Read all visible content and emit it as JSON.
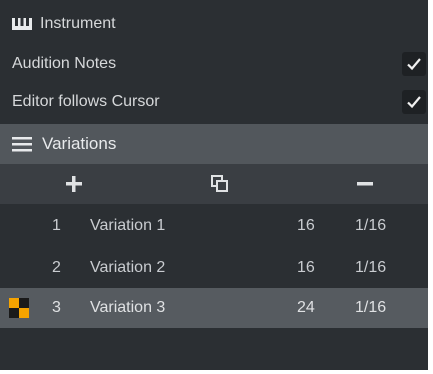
{
  "instrument_section": {
    "title": "Instrument",
    "icon": "piano-keys-icon"
  },
  "options": {
    "audition_notes": {
      "label": "Audition Notes",
      "checked": true
    },
    "editor_follows_cursor": {
      "label": "Editor follows Cursor",
      "checked": true
    }
  },
  "variations_section": {
    "title": "Variations",
    "icon": "hamburger-menu-icon",
    "toolbar": {
      "add": "plus-icon",
      "duplicate": "duplicate-icon",
      "remove": "minus-icon"
    },
    "rows": [
      {
        "index": "1",
        "name": "Variation 1",
        "length": "16",
        "resolution": "1/16",
        "active": false
      },
      {
        "index": "2",
        "name": "Variation 2",
        "length": "16",
        "resolution": "1/16",
        "active": false
      },
      {
        "index": "3",
        "name": "Variation 3",
        "length": "24",
        "resolution": "1/16",
        "active": true
      }
    ]
  },
  "colors": {
    "panel_bg": "#2b2f33",
    "header_bg": "#52575c",
    "toolbar_bg": "#3a3e43",
    "selected_row_bg": "#565b60",
    "active_indicator": "#f5a300"
  }
}
